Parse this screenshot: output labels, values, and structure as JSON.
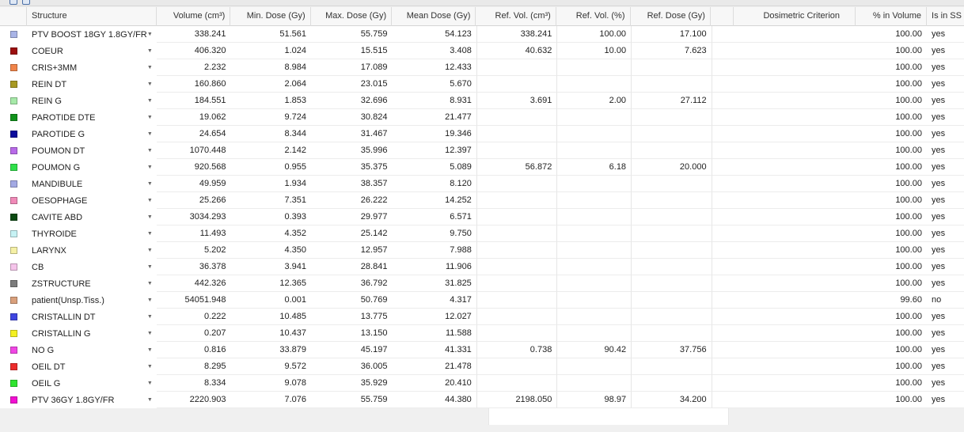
{
  "header": {
    "structure": "Structure",
    "volume": "Volume (cm³)",
    "min_dose": "Min. Dose (Gy)",
    "max_dose": "Max. Dose (Gy)",
    "mean_dose": "Mean Dose (Gy)",
    "ref_vol_cm3": "Ref. Vol. (cm³)",
    "ref_vol_pct": "Ref. Vol. (%)",
    "ref_dose": "Ref. Dose (Gy)",
    "dosimetric": "Dosimetric Criterion",
    "pct_in_volume": "% in Volume",
    "is_in_ss": "Is in SS"
  },
  "rows": [
    {
      "color": "#a9b4e6",
      "name": "PTV BOOST 18GY 1.8GY/FR",
      "volume": "338.241",
      "min": "51.561",
      "max": "55.759",
      "mean": "54.123",
      "ref_vol_cm3": "338.241",
      "ref_vol_pct": "100.00",
      "ref_dose": "17.100",
      "pct": "100.00",
      "ss": "yes"
    },
    {
      "color": "#9c0f0f",
      "name": "COEUR",
      "volume": "406.320",
      "min": "1.024",
      "max": "15.515",
      "mean": "3.408",
      "ref_vol_cm3": "40.632",
      "ref_vol_pct": "10.00",
      "ref_dose": "7.623",
      "pct": "100.00",
      "ss": "yes"
    },
    {
      "color": "#f0844a",
      "name": "CRIS+3MM",
      "volume": "2.232",
      "min": "8.984",
      "max": "17.089",
      "mean": "12.433",
      "ref_vol_cm3": "",
      "ref_vol_pct": "",
      "ref_dose": "",
      "pct": "100.00",
      "ss": "yes"
    },
    {
      "color": "#a89a23",
      "name": "REIN DT",
      "volume": "160.860",
      "min": "2.064",
      "max": "23.015",
      "mean": "5.670",
      "ref_vol_cm3": "",
      "ref_vol_pct": "",
      "ref_dose": "",
      "pct": "100.00",
      "ss": "yes"
    },
    {
      "color": "#a6e9a8",
      "name": "REIN G",
      "volume": "184.551",
      "min": "1.853",
      "max": "32.696",
      "mean": "8.931",
      "ref_vol_cm3": "3.691",
      "ref_vol_pct": "2.00",
      "ref_dose": "27.112",
      "pct": "100.00",
      "ss": "yes"
    },
    {
      "color": "#10921b",
      "name": "PAROTIDE DTE",
      "volume": "19.062",
      "min": "9.724",
      "max": "30.824",
      "mean": "21.477",
      "ref_vol_cm3": "",
      "ref_vol_pct": "",
      "ref_dose": "",
      "pct": "100.00",
      "ss": "yes"
    },
    {
      "color": "#0c0c9c",
      "name": "PAROTIDE G",
      "volume": "24.654",
      "min": "8.344",
      "max": "31.467",
      "mean": "19.346",
      "ref_vol_cm3": "",
      "ref_vol_pct": "",
      "ref_dose": "",
      "pct": "100.00",
      "ss": "yes"
    },
    {
      "color": "#b86ae8",
      "name": "POUMON DT",
      "volume": "1070.448",
      "min": "2.142",
      "max": "35.996",
      "mean": "12.397",
      "ref_vol_cm3": "",
      "ref_vol_pct": "",
      "ref_dose": "",
      "pct": "100.00",
      "ss": "yes"
    },
    {
      "color": "#2fe04a",
      "name": "POUMON G",
      "volume": "920.568",
      "min": "0.955",
      "max": "35.375",
      "mean": "5.089",
      "ref_vol_cm3": "56.872",
      "ref_vol_pct": "6.18",
      "ref_dose": "20.000",
      "pct": "100.00",
      "ss": "yes"
    },
    {
      "color": "#a3a9e3",
      "name": "MANDIBULE",
      "volume": "49.959",
      "min": "1.934",
      "max": "38.357",
      "mean": "8.120",
      "ref_vol_cm3": "",
      "ref_vol_pct": "",
      "ref_dose": "",
      "pct": "100.00",
      "ss": "yes"
    },
    {
      "color": "#f08ab8",
      "name": "OESOPHAGE",
      "volume": "25.266",
      "min": "7.351",
      "max": "26.222",
      "mean": "14.252",
      "ref_vol_cm3": "",
      "ref_vol_pct": "",
      "ref_dose": "",
      "pct": "100.00",
      "ss": "yes"
    },
    {
      "color": "#0b4a12",
      "name": "CAVITE ABD",
      "volume": "3034.293",
      "min": "0.393",
      "max": "29.977",
      "mean": "6.571",
      "ref_vol_cm3": "",
      "ref_vol_pct": "",
      "ref_dose": "",
      "pct": "100.00",
      "ss": "yes"
    },
    {
      "color": "#c6f2f4",
      "name": "THYROIDE",
      "volume": "11.493",
      "min": "4.352",
      "max": "25.142",
      "mean": "9.750",
      "ref_vol_cm3": "",
      "ref_vol_pct": "",
      "ref_dose": "",
      "pct": "100.00",
      "ss": "yes"
    },
    {
      "color": "#f5f0a6",
      "name": "LARYNX",
      "volume": "5.202",
      "min": "4.350",
      "max": "12.957",
      "mean": "7.988",
      "ref_vol_cm3": "",
      "ref_vol_pct": "",
      "ref_dose": "",
      "pct": "100.00",
      "ss": "yes"
    },
    {
      "color": "#f5c4ea",
      "name": "CB",
      "volume": "36.378",
      "min": "3.941",
      "max": "28.841",
      "mean": "11.906",
      "ref_vol_cm3": "",
      "ref_vol_pct": "",
      "ref_dose": "",
      "pct": "100.00",
      "ss": "yes"
    },
    {
      "color": "#7c7c7c",
      "name": "ZSTRUCTURE",
      "volume": "442.326",
      "min": "12.365",
      "max": "36.792",
      "mean": "31.825",
      "ref_vol_cm3": "",
      "ref_vol_pct": "",
      "ref_dose": "",
      "pct": "100.00",
      "ss": "yes"
    },
    {
      "color": "#d9a07c",
      "name": "patient(Unsp.Tiss.)",
      "volume": "54051.948",
      "min": "0.001",
      "max": "50.769",
      "mean": "4.317",
      "ref_vol_cm3": "",
      "ref_vol_pct": "",
      "ref_dose": "",
      "pct": "99.60",
      "ss": "no"
    },
    {
      "color": "#3f46e0",
      "name": "CRISTALLIN DT",
      "volume": "0.222",
      "min": "10.485",
      "max": "13.775",
      "mean": "12.027",
      "ref_vol_cm3": "",
      "ref_vol_pct": "",
      "ref_dose": "",
      "pct": "100.00",
      "ss": "yes"
    },
    {
      "color": "#f4f022",
      "name": "CRISTALLIN G",
      "volume": "0.207",
      "min": "10.437",
      "max": "13.150",
      "mean": "11.588",
      "ref_vol_cm3": "",
      "ref_vol_pct": "",
      "ref_dose": "",
      "pct": "100.00",
      "ss": "yes"
    },
    {
      "color": "#f046e4",
      "name": "NO G",
      "volume": "0.816",
      "min": "33.879",
      "max": "45.197",
      "mean": "41.331",
      "ref_vol_cm3": "0.738",
      "ref_vol_pct": "90.42",
      "ref_dose": "37.756",
      "pct": "100.00",
      "ss": "yes"
    },
    {
      "color": "#ec2c2c",
      "name": "OEIL DT",
      "volume": "8.295",
      "min": "9.572",
      "max": "36.005",
      "mean": "21.478",
      "ref_vol_cm3": "",
      "ref_vol_pct": "",
      "ref_dose": "",
      "pct": "100.00",
      "ss": "yes"
    },
    {
      "color": "#2fe42f",
      "name": "OEIL G",
      "volume": "8.334",
      "min": "9.078",
      "max": "35.929",
      "mean": "20.410",
      "ref_vol_cm3": "",
      "ref_vol_pct": "",
      "ref_dose": "",
      "pct": "100.00",
      "ss": "yes"
    },
    {
      "color": "#f210d2",
      "name": "PTV 36GY 1.8GY/FR",
      "volume": "2220.903",
      "min": "7.076",
      "max": "55.759",
      "mean": "44.380",
      "ref_vol_cm3": "2198.050",
      "ref_vol_pct": "98.97",
      "ref_dose": "34.200",
      "pct": "100.00",
      "ss": "yes"
    }
  ]
}
